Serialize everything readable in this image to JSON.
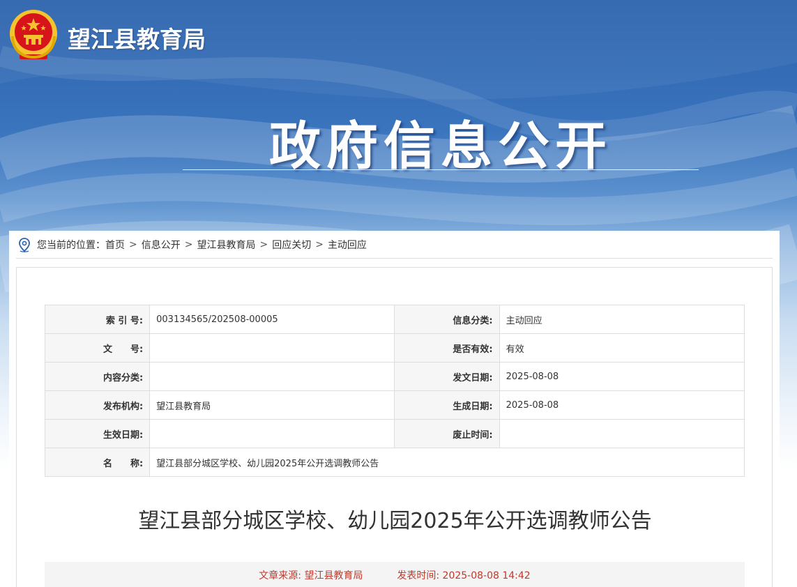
{
  "header": {
    "site_title": "望江县教育局",
    "hero_title": "政府信息公开"
  },
  "breadcrumb": {
    "prefix": "您当前的位置：",
    "items": [
      "首页",
      "信息公开",
      "望江县教育局",
      "回应关切",
      "主动回应"
    ],
    "separator": ">"
  },
  "meta": {
    "rows": [
      [
        {
          "label": "索 引 号:",
          "value": "003134565/202508-00005"
        },
        {
          "label": "信息分类:",
          "value": "主动回应"
        }
      ],
      [
        {
          "label": "文　　号:",
          "value": ""
        },
        {
          "label": "是否有效:",
          "value": "有效"
        }
      ],
      [
        {
          "label": "内容分类:",
          "value": ""
        },
        {
          "label": "发文日期:",
          "value": "2025-08-08"
        }
      ],
      [
        {
          "label": "发布机构:",
          "value": "望江县教育局"
        },
        {
          "label": "生成日期:",
          "value": "2025-08-08"
        }
      ],
      [
        {
          "label": "生效日期:",
          "value": ""
        },
        {
          "label": "废止时间:",
          "value": ""
        }
      ]
    ],
    "name_label": "名　　称:",
    "name_value": "望江县部分城区学校、幼儿园2025年公开选调教师公告"
  },
  "document": {
    "title": "望江县部分城区学校、幼儿园2025年公开选调教师公告",
    "source_label": "文章来源:",
    "source_value": "望江县教育局",
    "time_label": "发表时间:",
    "time_value": "2025-08-08 14:42"
  },
  "colors": {
    "banner_blue": "#2c63ad",
    "info_red": "#c0392b",
    "emblem_red": "#d7141a",
    "emblem_gold": "#f4c430"
  },
  "icons": {
    "emblem": "national-emblem-icon",
    "location": "location-pin-icon"
  }
}
